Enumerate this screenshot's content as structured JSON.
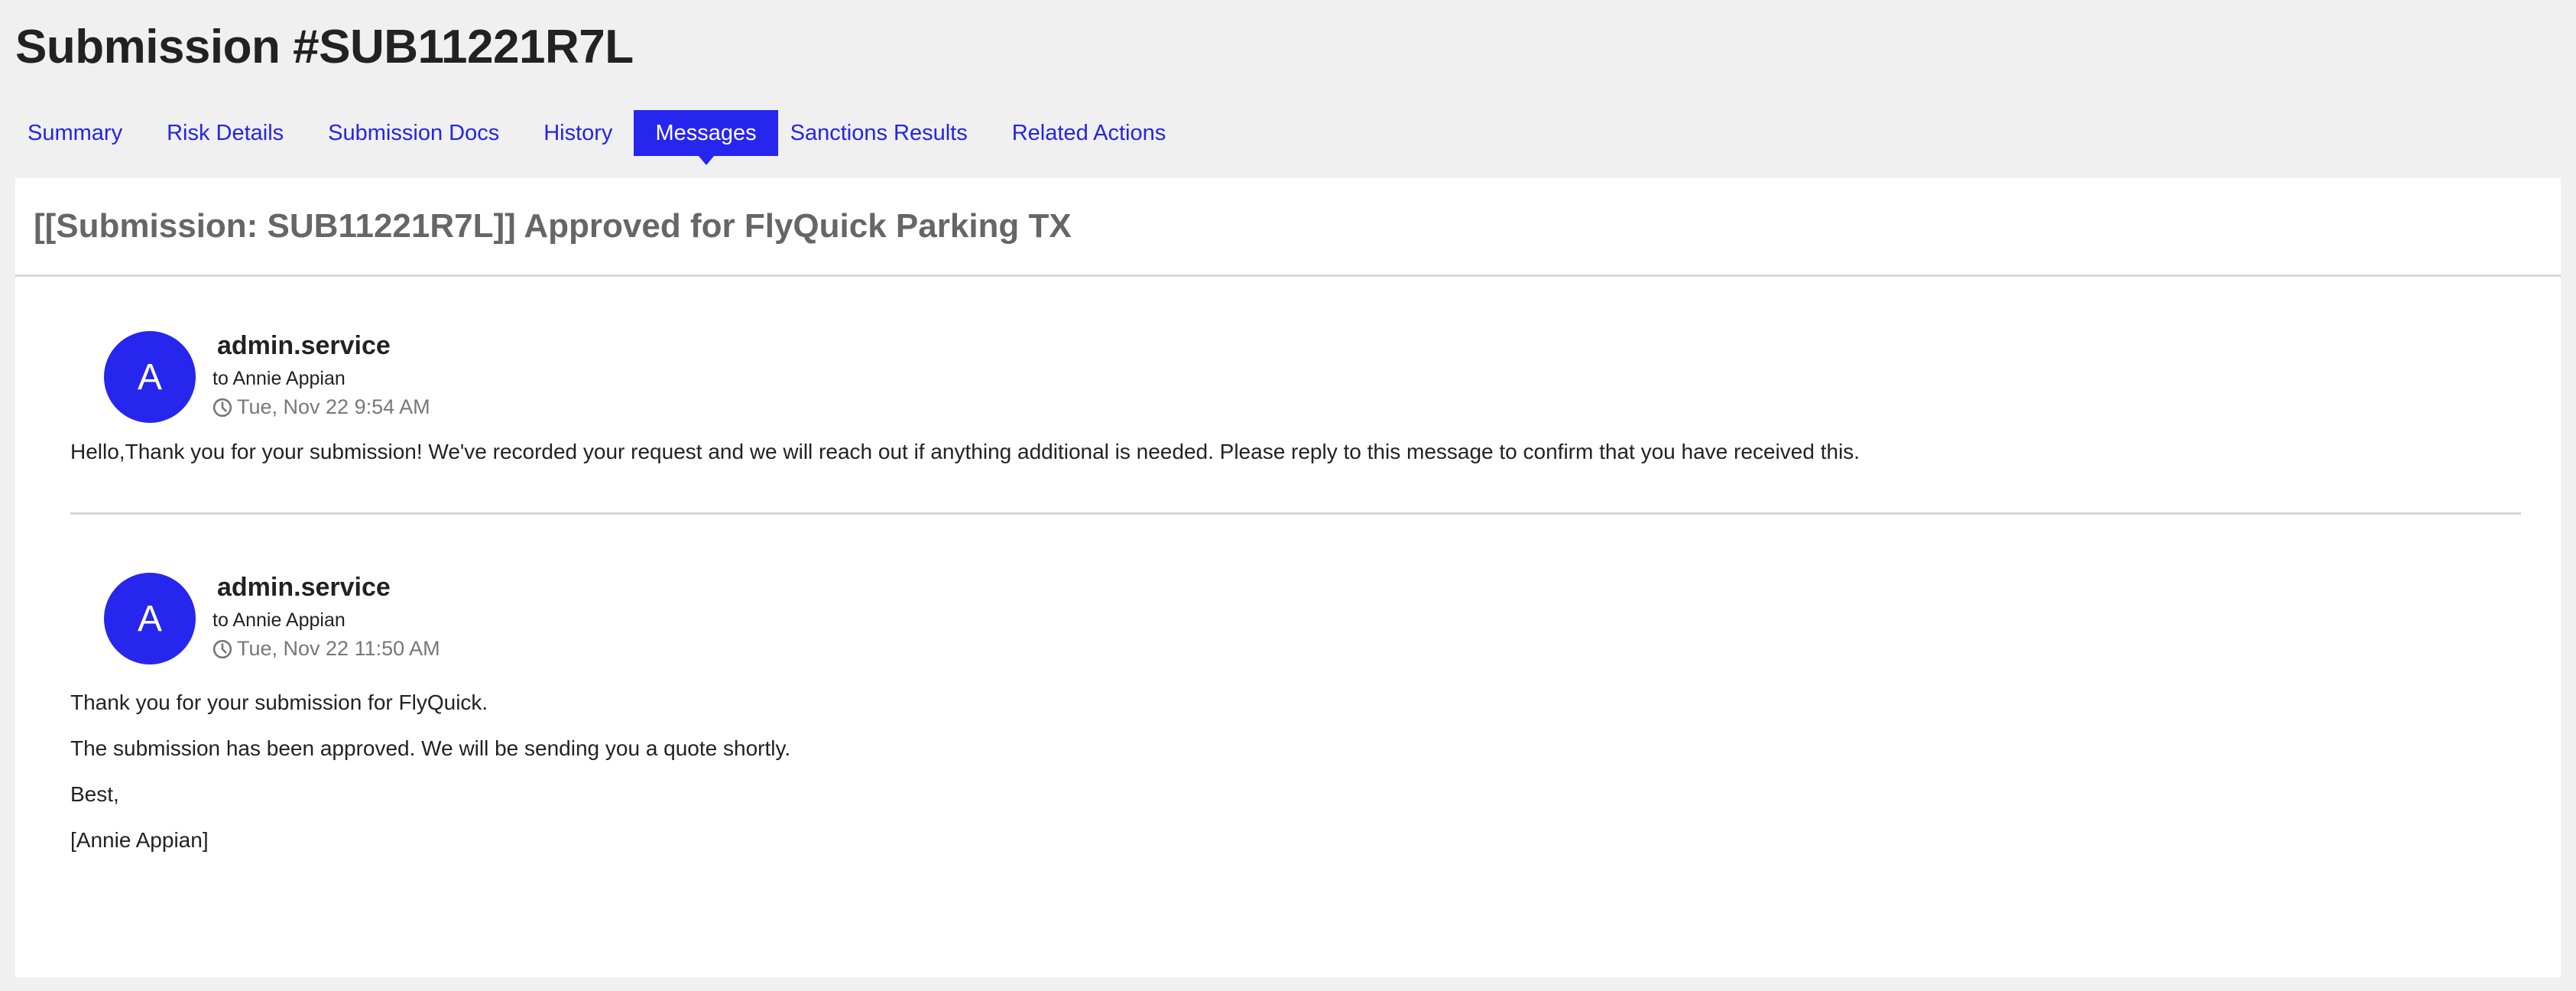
{
  "page": {
    "title": "Submission #SUB11221R7L"
  },
  "tabs": [
    {
      "label": "Summary",
      "active": false
    },
    {
      "label": "Risk Details",
      "active": false
    },
    {
      "label": "Submission Docs",
      "active": false
    },
    {
      "label": "History",
      "active": false
    },
    {
      "label": "Messages",
      "active": true
    },
    {
      "label": "Sanctions Results",
      "active": false
    },
    {
      "label": "Related Actions",
      "active": false
    }
  ],
  "thread": {
    "subject": "[[Submission: SUB11221R7L]] Approved for FlyQuick Parking TX",
    "messages": [
      {
        "avatar_initial": "A",
        "sender": "admin.service",
        "recipient": "to Annie Appian",
        "timestamp_icon": "clock-icon",
        "timestamp": "Tue, Nov 22 9:54 AM",
        "body": [
          "Hello,Thank you for your submission! We've recorded your request and we will reach out if anything additional is needed. Please reply to this message to confirm that you have received this."
        ]
      },
      {
        "avatar_initial": "A",
        "sender": "admin.service",
        "recipient": "to Annie Appian",
        "timestamp_icon": "clock-icon",
        "timestamp": "Tue, Nov 22 11:50 AM",
        "body": [
          "Thank you for your submission for FlyQuick.",
          "The submission has been approved. We will be sending you a quote shortly.",
          "Best,",
          "[Annie Appian]"
        ]
      }
    ]
  },
  "colors": {
    "accent": "#2626ee",
    "link": "#2424e6",
    "page_background": "#f0f0f0",
    "subject_text": "#666666",
    "divider": "#d6d6d6"
  }
}
